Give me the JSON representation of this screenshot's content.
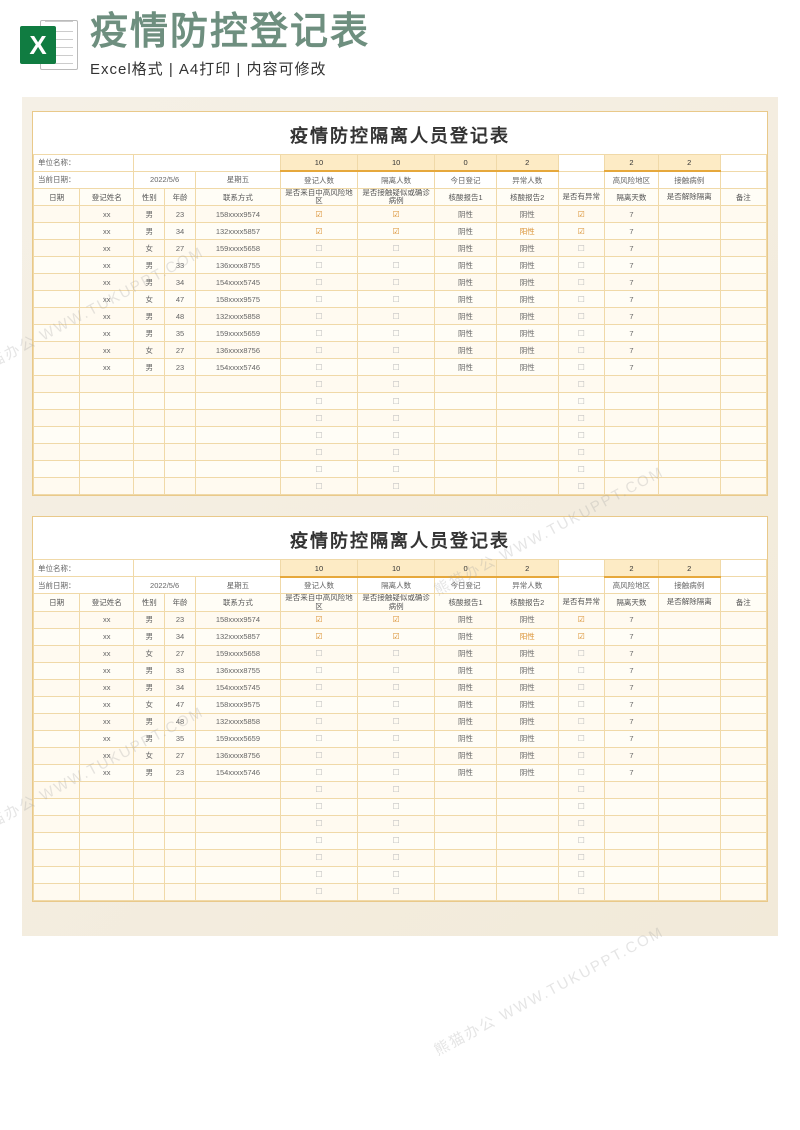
{
  "header": {
    "main_title": "疫情防控登记表",
    "sub_title": "Excel格式 | A4打印 | 内容可修改",
    "icon_letter": "X"
  },
  "sheet": {
    "title": "疫情防控隔离人员登记表",
    "unit_label": "单位名称：",
    "date_label": "当前日期：",
    "date_value": "2022/5/6",
    "weekday": "星期五",
    "summary": {
      "reg_count": {
        "label": "登记人数",
        "value": "10"
      },
      "iso_count": {
        "label": "隔离人数",
        "value": "10"
      },
      "today_reg": {
        "label": "今日登记",
        "value": "0"
      },
      "abnormal": {
        "label": "异常人数",
        "value": "2"
      },
      "high_risk": {
        "label": "高风险地区",
        "value": "2"
      },
      "contact": {
        "label": "接触病例",
        "value": "2"
      }
    },
    "columns": {
      "date": "日期",
      "name": "登记姓名",
      "sex": "性别",
      "age": "年龄",
      "phone": "联系方式",
      "risk": "是否来自中高风险地区",
      "contact": "是否接触疑似或确诊病例",
      "nuc1": "核酸报告1",
      "nuc2": "核酸报告2",
      "abn": "是否有异常",
      "days": "隔离天数",
      "release": "是否解除隔离",
      "note": "备注"
    },
    "rows": [
      {
        "name": "xx",
        "sex": "男",
        "age": "23",
        "phone": "158xxxx9574",
        "risk": true,
        "contact": true,
        "nuc1": "阴性",
        "nuc2": "阴性",
        "abn": true,
        "days": "7"
      },
      {
        "name": "xx",
        "sex": "男",
        "age": "34",
        "phone": "132xxxx5857",
        "risk": true,
        "contact": true,
        "nuc1": "阴性",
        "nuc2": "阳性",
        "abn": true,
        "days": "7",
        "nuc2_abn": true
      },
      {
        "name": "xx",
        "sex": "女",
        "age": "27",
        "phone": "159xxxx5658",
        "risk": false,
        "contact": false,
        "nuc1": "阴性",
        "nuc2": "阴性",
        "abn": false,
        "days": "7"
      },
      {
        "name": "xx",
        "sex": "男",
        "age": "33",
        "phone": "136xxxx8755",
        "risk": false,
        "contact": false,
        "nuc1": "阴性",
        "nuc2": "阴性",
        "abn": false,
        "days": "7"
      },
      {
        "name": "xx",
        "sex": "男",
        "age": "34",
        "phone": "154xxxx5745",
        "risk": false,
        "contact": false,
        "nuc1": "阴性",
        "nuc2": "阴性",
        "abn": false,
        "days": "7"
      },
      {
        "name": "xx",
        "sex": "女",
        "age": "47",
        "phone": "158xxxx9575",
        "risk": false,
        "contact": false,
        "nuc1": "阴性",
        "nuc2": "阴性",
        "abn": false,
        "days": "7"
      },
      {
        "name": "xx",
        "sex": "男",
        "age": "48",
        "phone": "132xxxx5858",
        "risk": false,
        "contact": false,
        "nuc1": "阴性",
        "nuc2": "阴性",
        "abn": false,
        "days": "7"
      },
      {
        "name": "xx",
        "sex": "男",
        "age": "35",
        "phone": "159xxxx5659",
        "risk": false,
        "contact": false,
        "nuc1": "阴性",
        "nuc2": "阴性",
        "abn": false,
        "days": "7"
      },
      {
        "name": "xx",
        "sex": "女",
        "age": "27",
        "phone": "136xxxx8756",
        "risk": false,
        "contact": false,
        "nuc1": "阴性",
        "nuc2": "阴性",
        "abn": false,
        "days": "7"
      },
      {
        "name": "xx",
        "sex": "男",
        "age": "23",
        "phone": "154xxxx5746",
        "risk": false,
        "contact": false,
        "nuc1": "阴性",
        "nuc2": "阴性",
        "abn": false,
        "days": "7"
      }
    ],
    "empty_rows": 7
  },
  "watermark": "熊猫办公 WWW.TUKUPPT.COM"
}
